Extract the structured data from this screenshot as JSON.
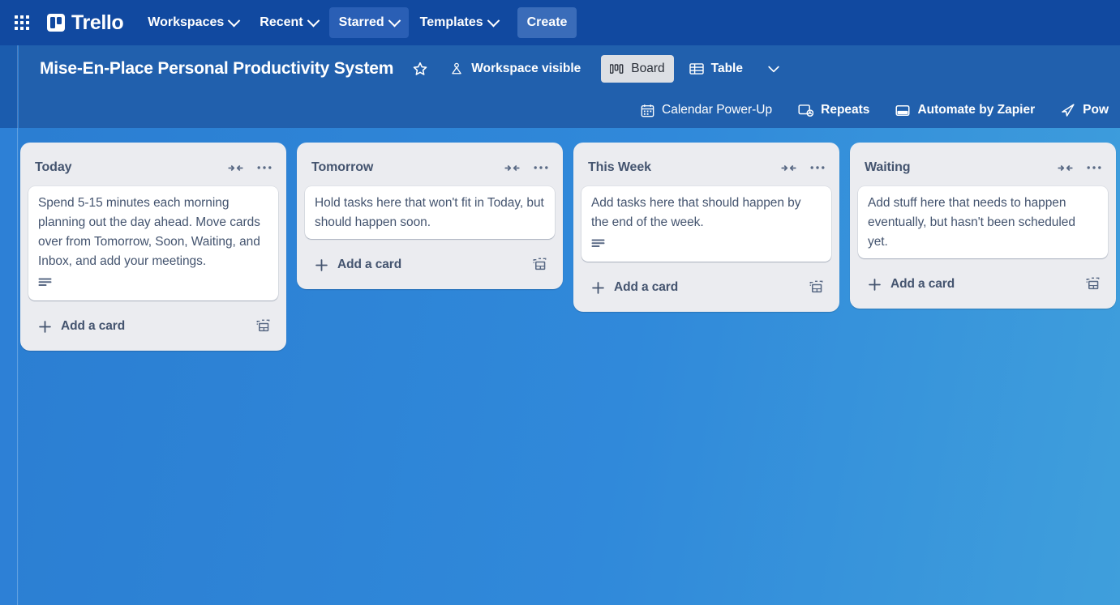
{
  "topnav": {
    "apps_icon": "apps-grid-icon",
    "brand": "Trello",
    "items": [
      {
        "label": "Workspaces",
        "has_chevron": true,
        "active": false
      },
      {
        "label": "Recent",
        "has_chevron": true,
        "active": false
      },
      {
        "label": "Starred",
        "has_chevron": true,
        "active": true
      },
      {
        "label": "Templates",
        "has_chevron": true,
        "active": false
      }
    ],
    "create_label": "Create"
  },
  "sidebar": {
    "expand_icon": "chevron-right-icon",
    "collapsed": true
  },
  "board_header": {
    "title": "Mise-En-Place Personal Productivity System",
    "star_icon": "star-icon",
    "visibility_icon": "workspace-visible-icon",
    "visibility_label": "Workspace visible",
    "views": [
      {
        "label": "Board",
        "icon": "board-view-icon",
        "selected": true
      },
      {
        "label": "Table",
        "icon": "table-view-icon",
        "selected": false
      }
    ],
    "more_views_icon": "chevron-down-icon",
    "power_ups": [
      {
        "label": "Calendar Power-Up",
        "icon": "calendar-icon"
      },
      {
        "label": "Repeats",
        "icon": "repeats-icon"
      },
      {
        "label": "Automate by Zapier",
        "icon": "zapier-icon"
      },
      {
        "label": "Pow",
        "icon": "paper-plane-icon",
        "truncated": true
      }
    ]
  },
  "board": {
    "lists": [
      {
        "title": "Today",
        "collapse_icon": "collapse-list-icon",
        "menu_icon": "list-actions-icon",
        "add_card_label": "Add a card",
        "add_card_icon": "plus-icon",
        "template_icon": "card-template-icon",
        "cards": [
          {
            "text": "Spend 5-15 minutes each morning planning out the day ahead. Move cards over from Tomorrow, Soon, Waiting, and Inbox, and add your meetings.",
            "badges": [
              "description-icon"
            ]
          }
        ]
      },
      {
        "title": "Tomorrow",
        "collapse_icon": "collapse-list-icon",
        "menu_icon": "list-actions-icon",
        "add_card_label": "Add a card",
        "add_card_icon": "plus-icon",
        "template_icon": "card-template-icon",
        "cards": [
          {
            "text": "Hold tasks here that won't fit in Today, but should happen soon.",
            "badges": []
          }
        ]
      },
      {
        "title": "This Week",
        "collapse_icon": "collapse-list-icon",
        "menu_icon": "list-actions-icon",
        "add_card_label": "Add a card",
        "add_card_icon": "plus-icon",
        "template_icon": "card-template-icon",
        "cards": [
          {
            "text": "Add tasks here that should happen by the end of the week.",
            "badges": [
              "description-icon"
            ]
          }
        ]
      },
      {
        "title": "Waiting",
        "collapse_icon": "collapse-list-icon",
        "menu_icon": "list-actions-icon",
        "add_card_label": "Add a card",
        "add_card_icon": "plus-icon",
        "template_icon": "card-template-icon",
        "cards": [
          {
            "text": "Add stuff here that needs to happen eventually, but hasn't been scheduled yet.",
            "badges": []
          }
        ]
      }
    ]
  },
  "colors": {
    "topnav_bg": "#1149a0",
    "board_header_bg": "#2160ad",
    "board_bg": "#3083d9",
    "list_bg": "#ebecf0",
    "card_bg": "#ffffff",
    "text_muted": "#44546f"
  }
}
